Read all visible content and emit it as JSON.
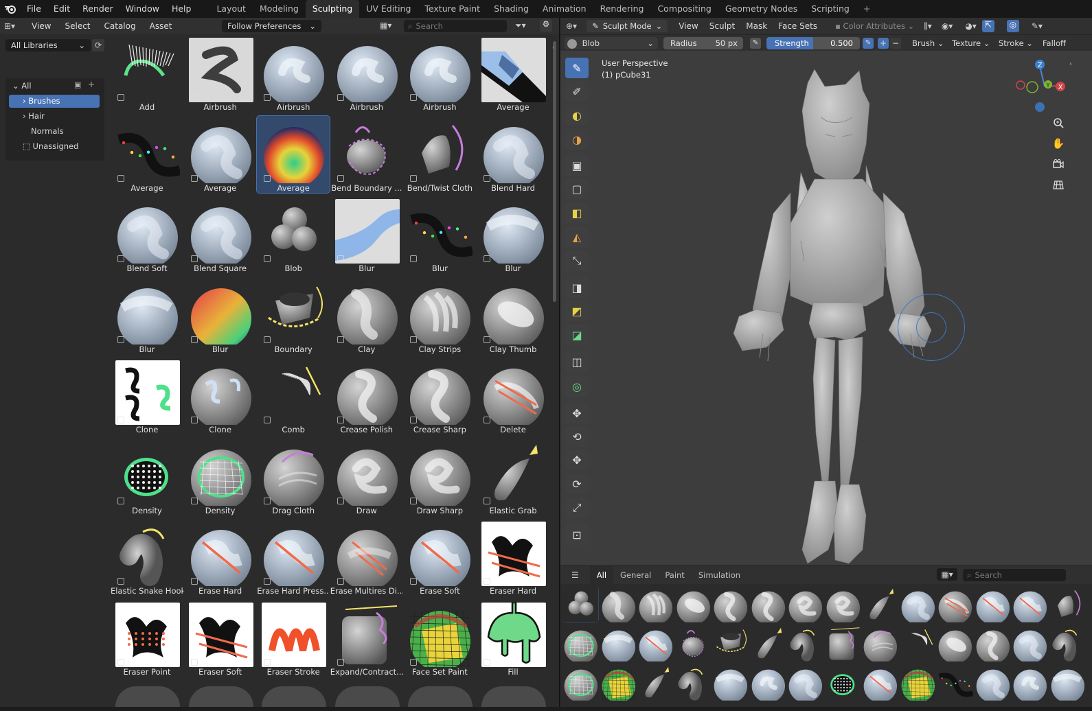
{
  "menubar": {
    "items": [
      "File",
      "Edit",
      "Render",
      "Window",
      "Help"
    ],
    "workspaces": [
      "Layout",
      "Modeling",
      "Sculpting",
      "UV Editing",
      "Texture Paint",
      "Shading",
      "Animation",
      "Rendering",
      "Compositing",
      "Geometry Nodes",
      "Scripting",
      "+"
    ],
    "active_workspace": "Sculpting"
  },
  "asset_browser": {
    "header": {
      "menus": [
        "View",
        "Select",
        "Catalog",
        "Asset"
      ],
      "import_method": "Follow Preferences",
      "search_placeholder": "Search"
    },
    "library": "All Libraries",
    "tree": {
      "root": "All",
      "items": [
        {
          "label": "Brushes",
          "expandable": true,
          "selected": true
        },
        {
          "label": "Hair",
          "expandable": true,
          "selected": false
        },
        {
          "label": "Normals",
          "expandable": false,
          "selected": false
        },
        {
          "label": "Unassigned",
          "expandable": false,
          "selected": false
        }
      ]
    },
    "brushes": [
      {
        "label": "Add",
        "thumb": "add"
      },
      {
        "label": "Airbrush",
        "thumb": "airbrush-dark"
      },
      {
        "label": "Airbrush",
        "thumb": "swirl"
      },
      {
        "label": "Airbrush",
        "thumb": "swirl"
      },
      {
        "label": "Airbrush",
        "thumb": "swirl"
      },
      {
        "label": "Average",
        "thumb": "average-stripe"
      },
      {
        "label": "Average",
        "thumb": "dotted-curve"
      },
      {
        "label": "Average",
        "thumb": "soft-blob"
      },
      {
        "label": "Average",
        "thumb": "heatmap",
        "selected": true
      },
      {
        "label": "Bend Boundary ...",
        "thumb": "bend-boundary"
      },
      {
        "label": "Bend/Twist Cloth",
        "thumb": "twist-cloth"
      },
      {
        "label": "Blend Hard",
        "thumb": "soft-blob"
      },
      {
        "label": "Blend Soft",
        "thumb": "soft-blob"
      },
      {
        "label": "Blend Square",
        "thumb": "soft-blob"
      },
      {
        "label": "Blob",
        "thumb": "blob"
      },
      {
        "label": "Blur",
        "thumb": "blue-curve"
      },
      {
        "label": "Blur",
        "thumb": "dotted-curve"
      },
      {
        "label": "Blur",
        "thumb": "sphere-blur"
      },
      {
        "label": "Blur",
        "thumb": "sphere-blur"
      },
      {
        "label": "Blur",
        "thumb": "rainbow"
      },
      {
        "label": "Boundary",
        "thumb": "boundary"
      },
      {
        "label": "Clay",
        "thumb": "clay"
      },
      {
        "label": "Clay Strips",
        "thumb": "clay-strips"
      },
      {
        "label": "Clay Thumb",
        "thumb": "clay-thumb"
      },
      {
        "label": "Clone",
        "thumb": "clone-white"
      },
      {
        "label": "Clone",
        "thumb": "clone-dark"
      },
      {
        "label": "Comb",
        "thumb": "comb"
      },
      {
        "label": "Crease Polish",
        "thumb": "crease"
      },
      {
        "label": "Crease Sharp",
        "thumb": "crease"
      },
      {
        "label": "Delete",
        "thumb": "delete"
      },
      {
        "label": "Density",
        "thumb": "density"
      },
      {
        "label": "Density",
        "thumb": "density-mesh"
      },
      {
        "label": "Drag Cloth",
        "thumb": "drag-cloth"
      },
      {
        "label": "Draw",
        "thumb": "draw"
      },
      {
        "label": "Draw Sharp",
        "thumb": "draw"
      },
      {
        "label": "Elastic Grab",
        "thumb": "elastic-grab"
      },
      {
        "label": "Elastic Snake Hook",
        "thumb": "snake"
      },
      {
        "label": "Erase Hard",
        "thumb": "erase"
      },
      {
        "label": "Erase Hard Press...",
        "thumb": "erase"
      },
      {
        "label": "Erase Multires Di...",
        "thumb": "erase-multires"
      },
      {
        "label": "Erase Soft",
        "thumb": "erase"
      },
      {
        "label": "Eraser Hard",
        "thumb": "eraser-white"
      },
      {
        "label": "Eraser Point",
        "thumb": "eraser-point"
      },
      {
        "label": "Eraser Soft",
        "thumb": "eraser-white"
      },
      {
        "label": "Eraser Stroke",
        "thumb": "eraser-stroke"
      },
      {
        "label": "Expand/Contract...",
        "thumb": "expand"
      },
      {
        "label": "Face Set Paint",
        "thumb": "faceset"
      },
      {
        "label": "Fill",
        "thumb": "fill"
      }
    ]
  },
  "viewport": {
    "header": {
      "mode": "Sculpt Mode",
      "menus": [
        "View",
        "Sculpt",
        "Mask",
        "Face Sets"
      ],
      "color_attributes": "Color Attributes"
    },
    "tool_settings": {
      "brush": "Blob",
      "radius_label": "Radius",
      "radius_value": "50 px",
      "strength_label": "Strength",
      "strength_value": "0.500",
      "strength_fraction": 0.5,
      "menus": [
        "Brush",
        "Texture",
        "Stroke",
        "Falloff"
      ]
    },
    "overlay_text": {
      "perspective": "User Perspective",
      "object": "(1) pCube31"
    },
    "gizmo_axes": [
      "Z",
      "Y",
      "X"
    ],
    "tools": [
      "draw-icon",
      "draw-sharp-icon",
      "clay-icon",
      "clay-strips-icon",
      "layer-icon",
      "inflate-icon",
      "blob-icon",
      "crease-icon",
      "smooth-icon",
      "flatten-icon",
      "fill-icon",
      "scrape-icon",
      "multiplane-icon",
      "pinch-icon",
      "grab-icon",
      "elastic-icon",
      "move-icon",
      "rotate-icon",
      "scale-icon",
      "transform-icon",
      "annotate-icon"
    ]
  },
  "shelf": {
    "tabs": [
      "All",
      "General",
      "Paint",
      "Simulation"
    ],
    "active_tab": "All",
    "search_placeholder": "Search"
  },
  "colors": {
    "accent": "#4772b3",
    "selected_tile": "#334a6d",
    "panel": "#2b2b2b",
    "viewport": "#3d3d3d"
  }
}
